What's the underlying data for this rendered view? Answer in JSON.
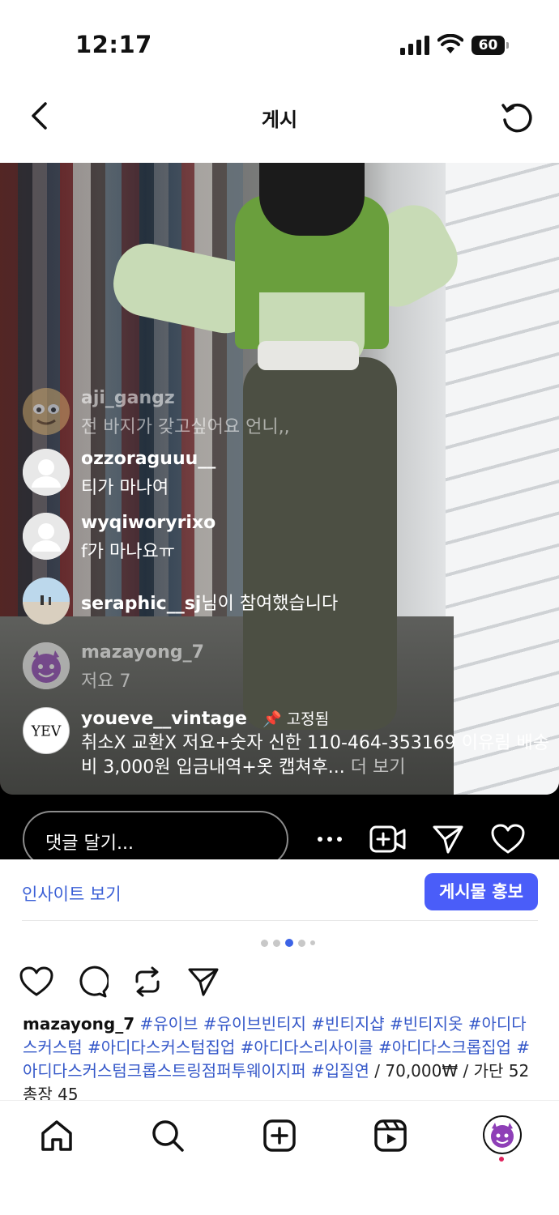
{
  "status_bar": {
    "time": "12:17",
    "battery": "60"
  },
  "header": {
    "title": "게시"
  },
  "comments": [
    {
      "user": "aji_gangz",
      "text": "전 바지가 갖고싶어요 언니,,",
      "avatar": "cartoon-avatar"
    },
    {
      "user": "ozzoraguuu__",
      "text": "티가 마나여",
      "avatar": "default-avatar"
    },
    {
      "user": "wyqiworyrixo",
      "text": "f가 마나요ㅠ",
      "avatar": "default-avatar"
    }
  ],
  "join": {
    "user": "seraphic__sj",
    "suffix": "님이 참여했습니다"
  },
  "comment_mazayong": {
    "user": "mazayong_7",
    "text": "저요 7"
  },
  "pinned": {
    "user": "youeve__vintage",
    "pin_label": "고정됨",
    "text": "취소X 교환X 저요+숫자 신한 110-464-353169 이유림 배송비 3,000원 입금내역+옷 캡쳐후...",
    "more": "더 보기",
    "avatar_logo": "YEV"
  },
  "comment_input": {
    "placeholder": "댓글 달기..."
  },
  "insight": {
    "label": "인사이트 보기"
  },
  "promote": {
    "label": "게시물 홍보"
  },
  "carousel": {
    "count": 5,
    "active_index": 2
  },
  "caption": {
    "user": "mazayong_7",
    "tags": "#유이브 #유이브빈티지 #빈티지샵 #빈티지옷 #아디다스커스텀 #아디다스커스텀집업 #아디다스리사이클 #아디다스크롭집업 #아디다스커스텀크롭스트링점퍼투웨이지퍼 #입질연",
    "tail": " / 70,000₩ / 가단 52 총장 45"
  },
  "colors": {
    "accent": "#4a5df9",
    "link": "#3558c9",
    "notification": "#e0245e"
  }
}
